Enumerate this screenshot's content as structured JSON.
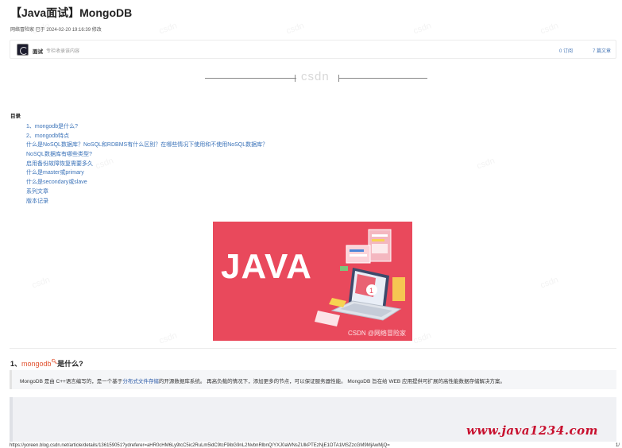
{
  "page": {
    "title": "【Java面试】MongoDB",
    "meta": "网络冒险家 已于 2024-02-20 19:16:39 修改"
  },
  "author": {
    "name": "面试",
    "description": "专栏收录该内容",
    "subscribers": "0 订阅",
    "posts": "7 篇文章"
  },
  "divider": {
    "logo_text": "csdn"
  },
  "toc": {
    "title": "目录",
    "items": [
      "1、mongodb是什么?",
      "2、mongodb特点",
      "什么是NoSQL数据库？NoSQL和RDBMS有什么区别？在哪些情况下使用和不使用NoSQL数据库？",
      "NoSQL数据库有哪些类型?",
      "启用备份故障恢复需要多久",
      "什么是master或primary",
      "什么是secondary或slave",
      "系列文章",
      "版本记录"
    ]
  },
  "banner": {
    "text": "JAVA",
    "watermark": "CSDN @网络冒险家",
    "colors": {
      "background": "#e9495c"
    }
  },
  "section": {
    "number": "1、",
    "link": "mongodb",
    "suffix": "是什么?"
  },
  "paragraph": {
    "before": "MongoDB 是由 C++语言编写的，是一个基于",
    "highlight": "分布式文件存储",
    "after": "的开源数据库系统。  再高负载的情况下，添加更多的节点，可以保证服务器性能。  MongoDB 旨在给 WEB 应用提供可扩展的高性能数据存储解决方案。"
  },
  "watermarks": {
    "site": "www.java1234.com",
    "tile": "csdn"
  },
  "footer": {
    "url": "https://yoreen.blog.csdn.net/article/details/136159051?ydreferer=aHR0cHM6Ly9tcC5ic2RuLm5ldC9tcF9ibG9nL2NvbnRlbnQ/YXJ0aWNsZUlkPTEzNjE1OTA1MSZzcGM9MjAwMjQ=",
    "page": "1/"
  },
  "colors": {
    "link": "#3a72b8",
    "accent": "#e0522f",
    "site_watermark": "#c8102e"
  }
}
